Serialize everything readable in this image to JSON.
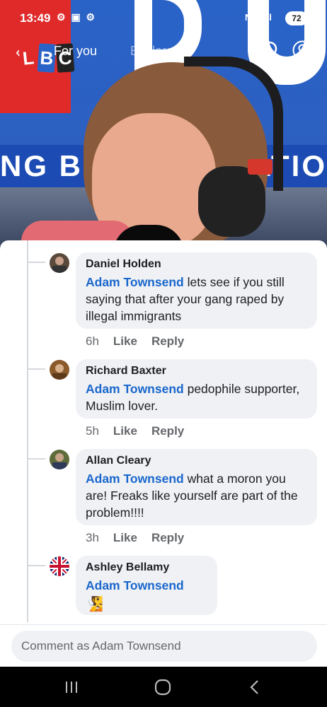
{
  "status_bar": {
    "time": "13:49",
    "app_icons": "⚙ ▣ ⚙",
    "signal": "N ⯈ .ıl",
    "battery": "72"
  },
  "app_header": {
    "logo_letters": [
      "L",
      "B",
      "C"
    ],
    "tabs": [
      {
        "label": "For you",
        "active": true
      },
      {
        "label": "Explore",
        "active": false
      }
    ]
  },
  "video": {
    "banner_left": "NG BRIT",
    "banner_right": "ATIO"
  },
  "comments": [
    {
      "author": "Daniel Holden",
      "mention": "Adam Townsend",
      "text": " lets see if you still saying that after your gang raped by illegal immigrants",
      "time": "6h",
      "like_label": "Like",
      "reply_label": "Reply",
      "avatar_color": "#5a4a3c"
    },
    {
      "author": "Richard Baxter",
      "mention": "Adam Townsend",
      "text": " pedophile supporter, Muslim lover.",
      "time": "5h",
      "like_label": "Like",
      "reply_label": "Reply",
      "avatar_color": "#8b5a2b"
    },
    {
      "author": "Allan Cleary",
      "mention": "Adam Townsend",
      "text": " what a moron you are! Freaks like yourself are part of the problem!!!!",
      "time": "3h",
      "like_label": "Like",
      "reply_label": "Reply",
      "avatar_color": "#5e6b3a"
    },
    {
      "author": "Ashley Bellamy",
      "mention": "Adam Townsend",
      "emoji": "🧏",
      "avatar_color": "#012169"
    }
  ],
  "comment_input": {
    "placeholder": "Comment as Adam Townsend"
  },
  "icons": {
    "search": "search-icon",
    "profile": "profile-icon",
    "back": "back-arrow-icon",
    "nav_recent": "recent-apps-icon",
    "nav_home": "home-icon",
    "nav_back": "nav-back-icon"
  },
  "colors": {
    "mention": "#1a67cc",
    "bubble": "#eff1f4",
    "secondary_text": "#65676b"
  }
}
